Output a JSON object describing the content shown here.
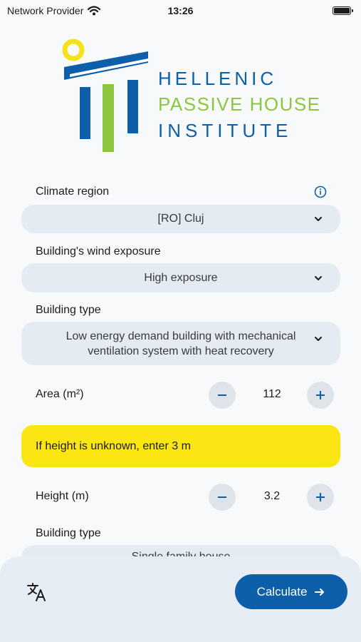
{
  "status_bar": {
    "carrier": "Network Provider",
    "time": "13:26"
  },
  "logo": {
    "line1": "HELLENIC",
    "line2": "PASSIVE HOUSE",
    "line3": "INSTITUTE"
  },
  "form": {
    "climate_region": {
      "label": "Climate region",
      "value": "[RO] Cluj"
    },
    "wind_exposure": {
      "label": "Building's wind exposure",
      "value": "High exposure"
    },
    "building_type": {
      "label": "Building type",
      "value": "Low energy demand building with mechanical ventilation system with heat recovery"
    },
    "area": {
      "label": "Area (m²)",
      "value": "112"
    },
    "height_hint": "If height is unknown, enter 3 m",
    "height": {
      "label": "Height (m)",
      "value": "3.2"
    },
    "building_type_2": {
      "label": "Building type",
      "value": "Single family house"
    }
  },
  "bottom": {
    "calculate_label": "Calculate"
  },
  "colors": {
    "primary": "#0c5fa8",
    "accent_green": "#8cc63f",
    "logo_yellow": "#f5e21b",
    "banner": "#fbe513"
  }
}
